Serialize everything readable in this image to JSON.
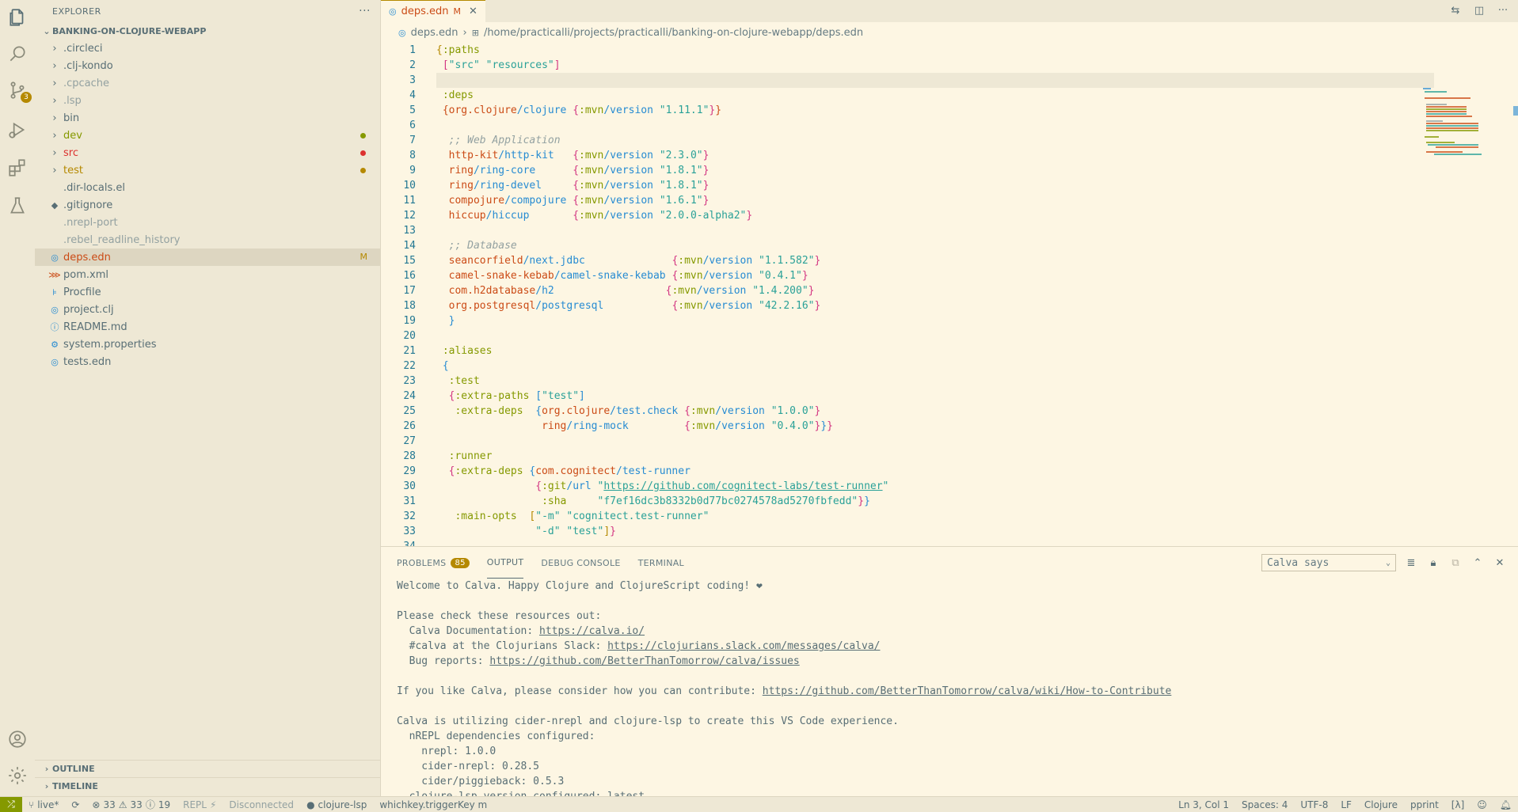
{
  "activity_bar": {
    "scm_badge": "3"
  },
  "sidebar": {
    "title": "EXPLORER",
    "more": "···",
    "project": "BANKING-ON-CLOJURE-WEBAPP",
    "items": [
      {
        "label": ".circleci",
        "type": "folder",
        "color": "#586e75"
      },
      {
        "label": ".clj-kondo",
        "type": "folder",
        "color": "#586e75"
      },
      {
        "label": ".cpcache",
        "type": "folder",
        "color": "#93a1a1"
      },
      {
        "label": ".lsp",
        "type": "folder",
        "color": "#93a1a1"
      },
      {
        "label": "bin",
        "type": "folder",
        "color": "#586e75"
      },
      {
        "label": "dev",
        "type": "folder",
        "color": "#859900",
        "dot": "#859900"
      },
      {
        "label": "src",
        "type": "folder",
        "color": "#dc322f",
        "dot": "#dc322f"
      },
      {
        "label": "test",
        "type": "folder",
        "color": "#b58900",
        "dot": "#b58900"
      },
      {
        "label": ".dir-locals.el",
        "type": "file",
        "color": "#586e75"
      },
      {
        "label": ".gitignore",
        "type": "file",
        "color": "#586e75",
        "icon": "◆"
      },
      {
        "label": ".nrepl-port",
        "type": "file",
        "color": "#93a1a1"
      },
      {
        "label": ".rebel_readline_history",
        "type": "file",
        "color": "#93a1a1"
      },
      {
        "label": "deps.edn",
        "type": "file",
        "color": "#cb4b16",
        "icon": "◎",
        "badge": "M",
        "selected": true
      },
      {
        "label": "pom.xml",
        "type": "file",
        "color": "#586e75",
        "icon": "⋙"
      },
      {
        "label": "Procfile",
        "type": "file",
        "color": "#586e75",
        "icon": "⊧"
      },
      {
        "label": "project.clj",
        "type": "file",
        "color": "#586e75",
        "icon": "◎"
      },
      {
        "label": "README.md",
        "type": "file",
        "color": "#586e75",
        "icon": "ⓘ"
      },
      {
        "label": "system.properties",
        "type": "file",
        "color": "#586e75",
        "icon": "⚙"
      },
      {
        "label": "tests.edn",
        "type": "file",
        "color": "#586e75",
        "icon": "◎"
      }
    ],
    "outline": "OUTLINE",
    "timeline": "TIMELINE"
  },
  "editor": {
    "tab_label": "deps.edn",
    "tab_modified": "M",
    "breadcrumb_file": "deps.edn",
    "breadcrumb_path": "/home/practicalli/projects/practicalli/banking-on-clojure-webapp/deps.edn",
    "line_numbers": [
      "1",
      "2",
      "3",
      "4",
      "5",
      "6",
      "7",
      "8",
      "9",
      "10",
      "11",
      "12",
      "13",
      "14",
      "15",
      "16",
      "17",
      "18",
      "19",
      "20",
      "21",
      "22",
      "23",
      "24",
      "25",
      "26",
      "27",
      "28",
      "29",
      "30",
      "31",
      "32",
      "33",
      "34"
    ]
  },
  "panel": {
    "tabs": [
      {
        "label": "PROBLEMS",
        "badge": "85"
      },
      {
        "label": "OUTPUT"
      },
      {
        "label": "DEBUG CONSOLE"
      },
      {
        "label": "TERMINAL"
      }
    ],
    "channel": "Calva says",
    "output": {
      "l1": "Welcome to Calva. Happy Clojure and ClojureScript coding! ❤",
      "l2": "Please check these resources out:",
      "l3a": "  Calva Documentation: ",
      "l3b": "https://calva.io/",
      "l4a": "  #calva at the Clojurians Slack: ",
      "l4b": "https://clojurians.slack.com/messages/calva/",
      "l5a": "  Bug reports: ",
      "l5b": "https://github.com/BetterThanTomorrow/calva/issues",
      "l6a": "If you like Calva, please consider how you can contribute: ",
      "l6b": "https://github.com/BetterThanTomorrow/calva/wiki/How-to-Contribute",
      "l7": "Calva is utilizing cider-nrepl and clojure-lsp to create this VS Code experience.",
      "l8": "  nREPL dependencies configured:",
      "l9": "    nrepl: 1.0.0",
      "l10": "    cider-nrepl: 0.28.5",
      "l11": "    cider/piggieback: 0.5.3",
      "l12": "  clojure-lsp version configured: latest"
    }
  },
  "status": {
    "branch": "live*",
    "errors": "33",
    "warnings": "33",
    "infos": "19",
    "repl": "REPL",
    "disconnected": "Disconnected",
    "lsp": "clojure-lsp",
    "whichkey": "whichkey.triggerKey m",
    "position": "Ln 3, Col 1",
    "spaces": "Spaces: 4",
    "encoding": "UTF-8",
    "eol": "LF",
    "language": "Clojure",
    "pprint": "pprint",
    "lambda": "[λ]"
  },
  "colors": {
    "accent": "#b58900",
    "background": "#fdf6e3",
    "sidebar": "#eee8d5"
  }
}
